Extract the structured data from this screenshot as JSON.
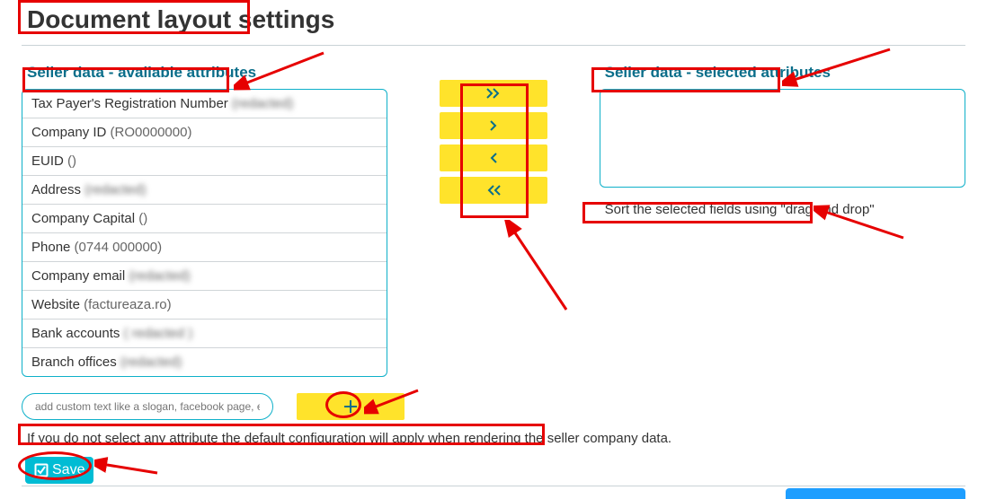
{
  "title": "Document layout settings",
  "left": {
    "heading": "Seller data - available attributes",
    "items": [
      {
        "label": "Tax Payer's Registration Number",
        "value": "(redacted)",
        "blur": true
      },
      {
        "label": "Company ID",
        "value": "(RO0000000)",
        "blur": false
      },
      {
        "label": "EUID",
        "value": "()",
        "blur": false
      },
      {
        "label": "Address",
        "value": "(redacted)",
        "blur": true
      },
      {
        "label": "Company Capital",
        "value": "()",
        "blur": false
      },
      {
        "label": "Phone",
        "value": "(0744 000000)",
        "blur": false
      },
      {
        "label": "Company email",
        "value": "(redacted)",
        "blur": true
      },
      {
        "label": "Website",
        "value": "(factureaza.ro)",
        "blur": false
      },
      {
        "label": "Bank accounts",
        "value": "( redacted )",
        "blur": true
      },
      {
        "label": "Branch offices",
        "value": "(redacted)",
        "blur": true
      }
    ]
  },
  "right": {
    "heading": "Seller data - selected attributes",
    "sort_hint": "Sort the selected fields using \"drag and drop\""
  },
  "custom": {
    "placeholder": "add custom text like a slogan, facebook page, etc."
  },
  "note": "If you do not select any attribute the default configuration will apply when rendering the seller company data.",
  "save_label": "Save"
}
